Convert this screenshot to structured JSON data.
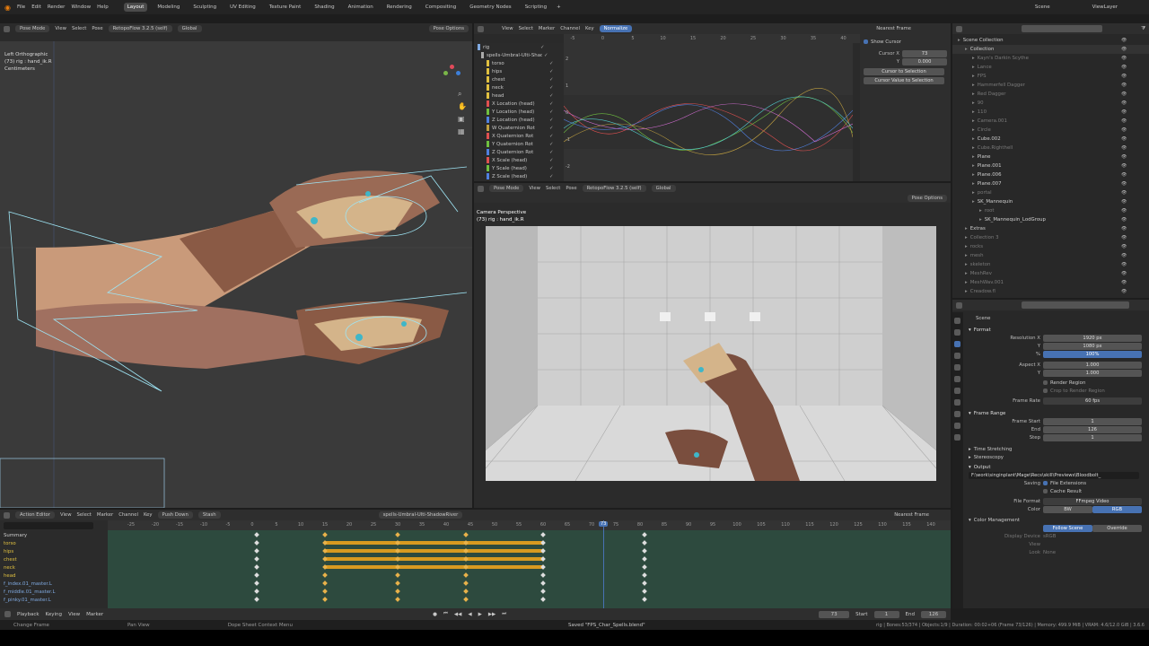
{
  "topbar": {
    "menus": [
      "File",
      "Edit",
      "Render",
      "Window",
      "Help"
    ],
    "workspaces": [
      "Layout",
      "Modeling",
      "Sculpting",
      "UV Editing",
      "Texture Paint",
      "Shading",
      "Animation",
      "Rendering",
      "Compositing",
      "Geometry Nodes",
      "Scripting"
    ],
    "active_workspace": "Layout",
    "scene": "Scene",
    "view_layer": "ViewLayer"
  },
  "viewport_left": {
    "mode": "Pose Mode",
    "menu": [
      "View",
      "Select",
      "Pose"
    ],
    "rig": "RetopoFlow 3.2.5 (self)",
    "orientation": "Global",
    "pose_options": "Pose Options",
    "info_title": "Left Orthographic",
    "info_rig": "(73) rig : hand_ik.R",
    "info_units": "Centimeters"
  },
  "graph_editor": {
    "menu": [
      "View",
      "Select",
      "Marker",
      "Channel",
      "Key"
    ],
    "normalize": "Normalize",
    "channels": [
      {
        "name": "rig",
        "color": "#7fa9e0"
      },
      {
        "name": "spells-Umbral-Ulti-ShadowRiver",
        "color": "#aaaaaa"
      },
      {
        "name": "torso",
        "color": "#e0c040"
      },
      {
        "name": "hips",
        "color": "#e0c040"
      },
      {
        "name": "chest",
        "color": "#e0c040"
      },
      {
        "name": "neck",
        "color": "#e0c040"
      },
      {
        "name": "head",
        "color": "#e0c040"
      },
      {
        "name": "X Location (head)",
        "color": "#e05050"
      },
      {
        "name": "Y Location (head)",
        "color": "#70c040"
      },
      {
        "name": "Z Location (head)",
        "color": "#5080e0"
      },
      {
        "name": "W Quaternion Rot",
        "color": "#c0a040"
      },
      {
        "name": "X Quaternion Rot",
        "color": "#e05050"
      },
      {
        "name": "Y Quaternion Rot",
        "color": "#70c040"
      },
      {
        "name": "Z Quaternion Rot",
        "color": "#5080e0"
      },
      {
        "name": "X Scale (head)",
        "color": "#e05050"
      },
      {
        "name": "Y Scale (head)",
        "color": "#70c040"
      },
      {
        "name": "Z Scale (head)",
        "color": "#5080e0"
      }
    ],
    "ruler": [
      "-5",
      "0",
      "5",
      "10",
      "15",
      "20",
      "25",
      "30",
      "35",
      "40"
    ],
    "yvals": [
      "2",
      "1",
      "0",
      "-1",
      "-2"
    ],
    "sidebar": {
      "show_cursor": "Show Cursor",
      "cursor_x_label": "Cursor X",
      "cursor_x": "73",
      "y_label": "Y",
      "y_val": "0.000",
      "btn1": "Cursor to Selection",
      "btn2": "Cursor Value to Selection"
    },
    "snap": "Nearest Frame"
  },
  "viewport_right": {
    "mode": "Pose Mode",
    "menu": [
      "View",
      "Select",
      "Pose"
    ],
    "rig": "RetopoFlow 3.2.5 (self)",
    "orientation": "Global",
    "pose_options": "Pose Options",
    "info_title": "Camera Perspective",
    "info_rig": "(73) rig : hand_ik.R"
  },
  "outliner": {
    "search_placeholder": "",
    "items": [
      {
        "name": "Scene Collection",
        "indent": 0,
        "dim": false
      },
      {
        "name": "Collection",
        "indent": 1,
        "dim": false
      },
      {
        "name": "Kayn's Darkin Scythe",
        "indent": 2,
        "dim": true
      },
      {
        "name": "Lance",
        "indent": 2,
        "dim": true
      },
      {
        "name": "FPS",
        "indent": 2,
        "dim": true
      },
      {
        "name": "Hammerfell Dagger",
        "indent": 2,
        "dim": true
      },
      {
        "name": "Red Dagger",
        "indent": 2,
        "dim": true
      },
      {
        "name": "90",
        "indent": 2,
        "dim": true
      },
      {
        "name": "110",
        "indent": 2,
        "dim": true
      },
      {
        "name": "Camera.001",
        "indent": 2,
        "dim": true
      },
      {
        "name": "Circle",
        "indent": 2,
        "dim": true
      },
      {
        "name": "Cube.002",
        "indent": 2,
        "dim": false
      },
      {
        "name": "Cube.Righthell",
        "indent": 2,
        "dim": true
      },
      {
        "name": "Plane",
        "indent": 2,
        "dim": false
      },
      {
        "name": "Plane.001",
        "indent": 2,
        "dim": false
      },
      {
        "name": "Plane.006",
        "indent": 2,
        "dim": false
      },
      {
        "name": "Plane.007",
        "indent": 2,
        "dim": false
      },
      {
        "name": "portal",
        "indent": 2,
        "dim": true
      },
      {
        "name": "SK_Mannequin",
        "indent": 2,
        "dim": false
      },
      {
        "name": "root",
        "indent": 3,
        "dim": true
      },
      {
        "name": "SK_Mannequin_LodGroup",
        "indent": 3,
        "dim": false
      },
      {
        "name": "Extras",
        "indent": 1,
        "dim": false
      },
      {
        "name": "Collection 3",
        "indent": 1,
        "dim": true
      },
      {
        "name": "rocks",
        "indent": 1,
        "dim": true
      },
      {
        "name": "mesh",
        "indent": 1,
        "dim": true
      },
      {
        "name": "skeleton",
        "indent": 1,
        "dim": true
      },
      {
        "name": "MeshRev",
        "indent": 1,
        "dim": true
      },
      {
        "name": "MeshWav.001",
        "indent": 1,
        "dim": true
      },
      {
        "name": "Creadow.fl",
        "indent": 1,
        "dim": true
      }
    ]
  },
  "properties": {
    "scene": "Scene",
    "format_label": "Format",
    "res_x_label": "Resolution X",
    "res_x": "1920 px",
    "res_y_label": "Y",
    "res_y": "1080 px",
    "pct_label": "%",
    "pct": "100%",
    "aspect_x_label": "Aspect X",
    "aspect_x": "1.000",
    "aspect_y_label": "Y",
    "aspect_y": "1.000",
    "render_region": "Render Region",
    "crop": "Crop to Render Region",
    "framerate_label": "Frame Rate",
    "framerate": "60 fps",
    "frame_range_label": "Frame Range",
    "frame_start_label": "Frame Start",
    "frame_start": "1",
    "end_label": "End",
    "end": "126",
    "step_label": "Step",
    "step": "1",
    "time_stretching": "Time Stretching",
    "stereoscopy": "Stereoscopy",
    "output_label": "Output",
    "output_path": "F:\\work\\singinplant\\Mage\\Recs\\skill\\Previews\\Bloodbolt_",
    "saving_label": "Saving",
    "file_ext": "File Extensions",
    "cache_result": "Cache Result",
    "file_format_label": "File Format",
    "file_format": "FFmpeg Video",
    "color_label": "Color",
    "bw": "BW",
    "rgb": "RGB",
    "color_mgmt": "Color Management",
    "follow_scene": "Follow Scene",
    "override": "Override",
    "display_device_label": "Display Device",
    "display_device": "sRGB",
    "view_label": "View",
    "look_label": "Look",
    "look": "None"
  },
  "dopesheet": {
    "mode": "Action Editor",
    "menu": [
      "View",
      "Select",
      "Marker",
      "Channel",
      "Key"
    ],
    "push_down": "Push Down",
    "stash": "Stash",
    "action": "spells-Umbral-Ulti-ShadowRiver",
    "snap": "Nearest Frame",
    "ruler": [
      "-25",
      "-20",
      "-15",
      "-10",
      "-5",
      "0",
      "5",
      "10",
      "15",
      "20",
      "25",
      "30",
      "35",
      "40",
      "45",
      "50",
      "55",
      "60",
      "65",
      "70",
      "75",
      "80",
      "85",
      "90",
      "95",
      "100",
      "105",
      "110",
      "115",
      "120",
      "125",
      "130",
      "135",
      "140"
    ],
    "current_frame": "73",
    "channels": [
      "Summary",
      "torso",
      "hips",
      "chest",
      "neck",
      "head",
      "f_index.01_master.L",
      "f_middle.01_master.L",
      "f_pinky.01_master.L"
    ]
  },
  "playback": {
    "menus": [
      "Playback",
      "Keying",
      "View",
      "Marker"
    ],
    "frame": "73",
    "start_label": "Start",
    "start": "1",
    "end_label": "End",
    "end": "126"
  },
  "status": {
    "left": "Change Frame",
    "pan": "Pan View",
    "context": "Dope Sheet Context Menu",
    "saved": "Saved \"FPS_Char_Spells.blend\"",
    "stats": "rig | Bones:53/374 | Objects:1/9 | Duration: 00:02+06 (Frame 73/126) | Memory: 499.9 MiB | VRAM: 4.6/12.0 GiB | 3.6.6"
  },
  "colors": {
    "accent": "#4772b3",
    "key_orange": "#e8a020",
    "timeline_bg": "#2d4a3e"
  }
}
